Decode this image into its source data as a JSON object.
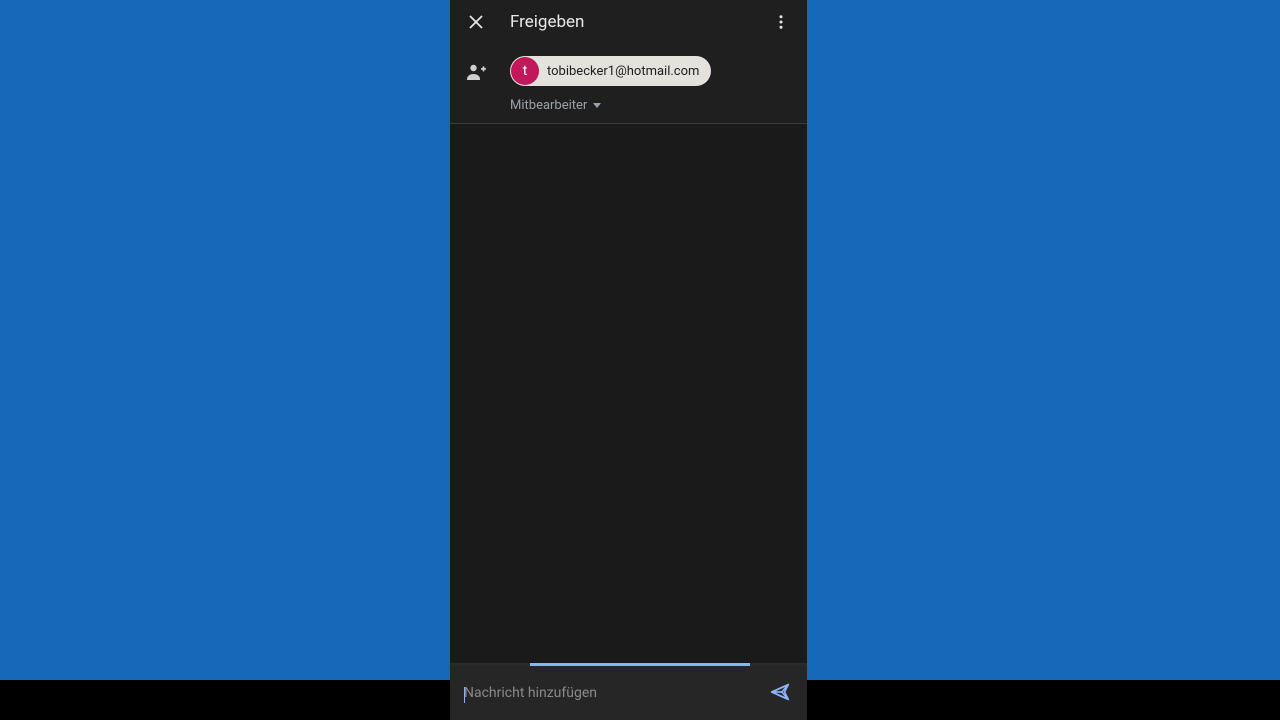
{
  "header": {
    "title": "Freigeben"
  },
  "recipient": {
    "avatar_initial": "t",
    "email": "tobibecker1@hotmail.com"
  },
  "role": {
    "label": "Mitbearbeiter"
  },
  "message": {
    "placeholder": "Nachricht hinzufügen"
  },
  "colors": {
    "background": "#1668b9",
    "surface": "#1f1f1f",
    "accent": "#8ab4f8",
    "avatar": "#c2185b"
  }
}
